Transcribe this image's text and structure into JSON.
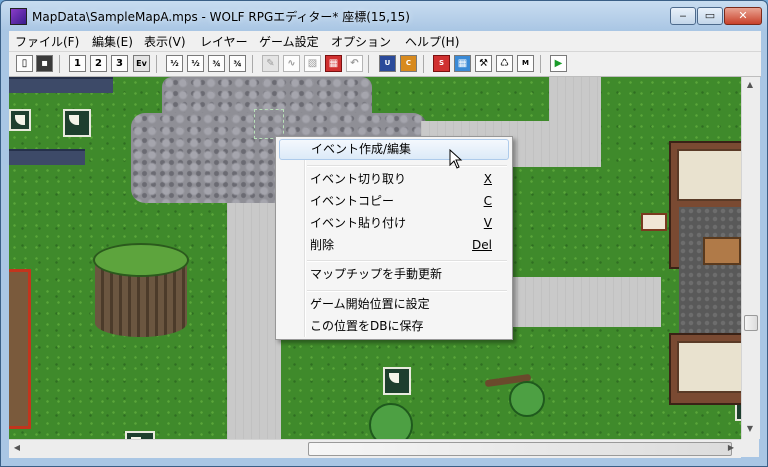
{
  "window": {
    "title": "MapData\\SampleMapA.mps - WOLF RPGエディター* 座標(15,15)",
    "controls": {
      "minimize": "‒",
      "maximize": "▭",
      "close": "✕"
    }
  },
  "menubar": [
    "ファイル(F)",
    "編集(E)",
    "表示(V)",
    "レイヤー",
    "ゲーム設定",
    "オプション",
    "ヘルプ(H)"
  ],
  "toolbar": {
    "layer_buttons": [
      "1",
      "2",
      "3",
      "Ev"
    ],
    "icons": [
      "new-file",
      "save",
      "layer-1",
      "layer-2",
      "layer-3",
      "event-layer",
      "edit-mode-1",
      "edit-mode-2",
      "edit-mode-3",
      "edit-mode-4",
      "pencil",
      "fill",
      "rectangle",
      "map-select",
      "undo",
      "user-db",
      "cdb",
      "system-db",
      "map-chip",
      "tools",
      "test-play"
    ]
  },
  "context_menu": {
    "items": [
      {
        "label": "イベント作成/編集",
        "key": "",
        "highlighted": true
      },
      {
        "label": "イベント切り取り",
        "key": "X"
      },
      {
        "label": "イベントコピー",
        "key": "C"
      },
      {
        "label": "イベント貼り付け",
        "key": "V"
      },
      {
        "label": "削除",
        "key": "Del"
      },
      {
        "label": "マップチップを手動更新",
        "key": ""
      },
      {
        "label": "ゲーム開始位置に設定",
        "key": ""
      },
      {
        "label": "この位置をDBに保存",
        "key": ""
      }
    ]
  },
  "colors": {
    "grass": "#3f8a2b",
    "stone": "#8f8f96",
    "path": "#c9c9c9",
    "menu_highlight": "#dceaf8"
  }
}
